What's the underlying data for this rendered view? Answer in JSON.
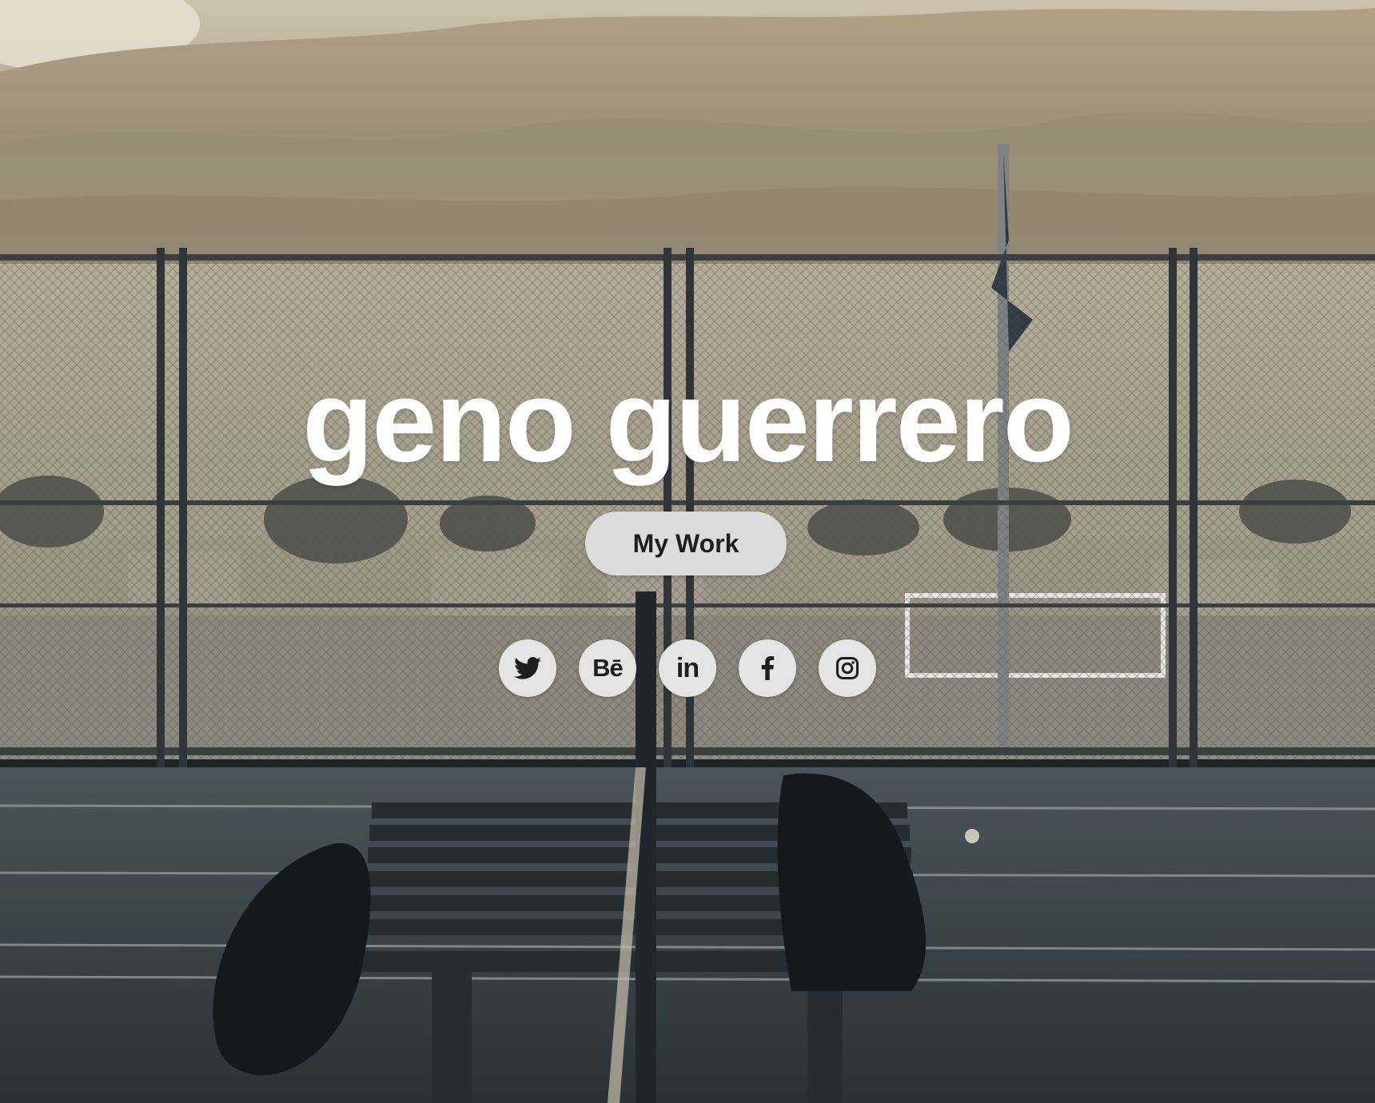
{
  "hero": {
    "background_description_icon": "tennis-court-photo",
    "title": "geno guerrero",
    "cta_label": "My Work",
    "colors": {
      "title": "#ffffff",
      "button_bg": "#dcdcdc",
      "button_text": "#1e1e1e",
      "photo_tint": "#bfb39a"
    }
  },
  "social": {
    "items": [
      {
        "icon": "twitter-icon",
        "glyph": ""
      },
      {
        "icon": "behance-icon",
        "glyph": "Bē"
      },
      {
        "icon": "linkedin-icon",
        "glyph": "in"
      },
      {
        "icon": "facebook-icon",
        "glyph": ""
      },
      {
        "icon": "instagram-icon",
        "glyph": ""
      }
    ]
  }
}
